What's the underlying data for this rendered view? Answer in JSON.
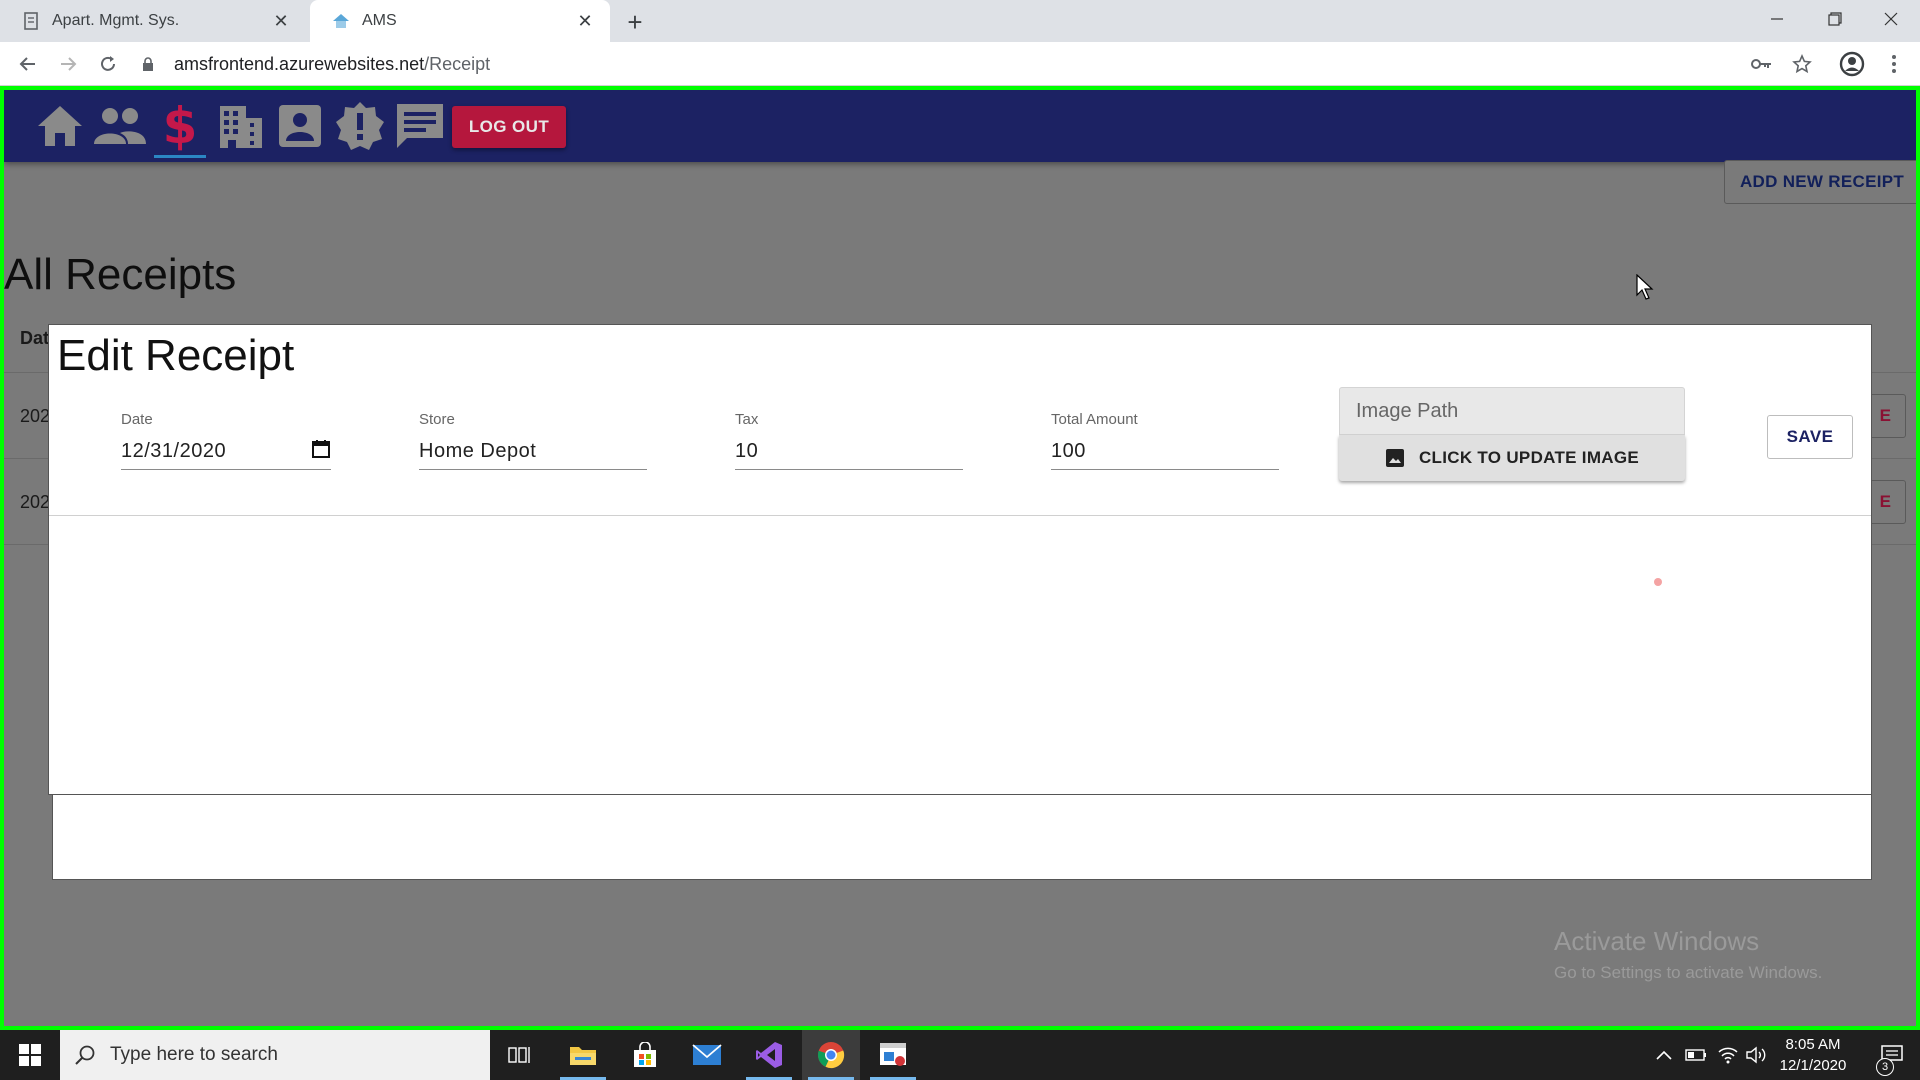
{
  "browser": {
    "tabs": [
      {
        "title": "Apart. Mgmt. Sys.",
        "active": false
      },
      {
        "title": "AMS",
        "active": true
      }
    ],
    "url_host": "amsfrontend.azurewebsites.net",
    "url_path": "/Receipt"
  },
  "app": {
    "nav": [
      "home-icon",
      "people-icon",
      "dollar-icon",
      "building-icon",
      "account-icon",
      "alert-icon",
      "message-icon"
    ],
    "dollar_glyph": "$",
    "logout_label": "LOG OUT",
    "add_receipt_label": "ADD NEW RECEIPT",
    "page_title": "All Receipts",
    "table_header_date": "Dat",
    "rows": [
      {
        "date": "202",
        "action": "E"
      },
      {
        "date": "202",
        "action": "E"
      }
    ]
  },
  "dialog": {
    "title": "Edit Receipt",
    "fields": {
      "date": {
        "label": "Date",
        "value": "12/31/2020"
      },
      "store": {
        "label": "Store",
        "value": "Home Depot"
      },
      "tax": {
        "label": "Tax",
        "value": "10"
      },
      "total": {
        "label": "Total Amount",
        "value": "100"
      }
    },
    "image_path_placeholder": "Image Path",
    "update_image_label": "CLICK TO UPDATE IMAGE",
    "save_label": "SAVE"
  },
  "watermark": {
    "line1": "Activate Windows",
    "line2": "Go to Settings to activate Windows."
  },
  "taskbar": {
    "search_placeholder": "Type here to search",
    "time": "8:05 AM",
    "date": "12/1/2020",
    "notifications": "3"
  },
  "colors": {
    "appbar": "#1c2263",
    "accent": "#c4184a",
    "selection": "#00ff00"
  }
}
